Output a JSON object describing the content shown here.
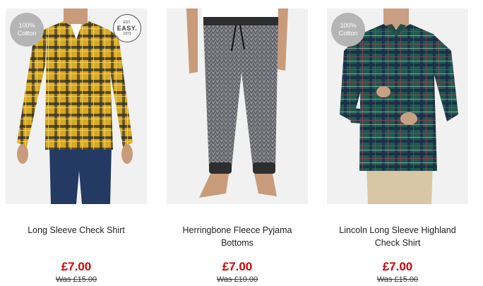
{
  "products": [
    {
      "name": "Long Sleeve Check Shirt",
      "price": "£7.00",
      "was_price": "Was £15.00",
      "badge_line1": "100%",
      "badge_line2": "Cotton",
      "brand_stamp": {
        "top": "EST.",
        "word": "EASY.",
        "year": "1973"
      }
    },
    {
      "name": "Herringbone Fleece Pyjama Bottoms",
      "price": "£7.00",
      "was_price": "Was £10.00"
    },
    {
      "name": "Lincoln Long Sleeve Highland Check Shirt",
      "price": "£7.00",
      "was_price": "Was £15.00",
      "badge_line1": "100%",
      "badge_line2": "Cotton"
    }
  ],
  "colors": {
    "price_red": "#d50000",
    "badge_grey": "#b5b5b5",
    "image_bg": "#f1f1f1"
  }
}
